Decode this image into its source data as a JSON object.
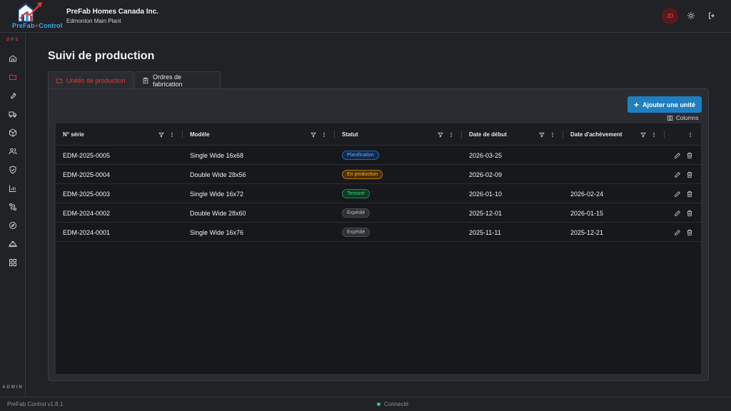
{
  "header": {
    "logo_text_a": "PreFab",
    "logo_text_sep": "+",
    "logo_text_b": "Control",
    "company": "PreFab Homes Canada Inc.",
    "plant": "Edmonton Main Plant",
    "avatar_initials": "JD"
  },
  "sidebar": {
    "section_ops": "OPS",
    "section_admin": "ADMIN",
    "items": [
      "home-icon",
      "folder-icon",
      "wrench-icon",
      "truck-icon",
      "box-icon",
      "users-icon",
      "shield-icon",
      "chart-icon",
      "route-icon",
      "compass-icon",
      "hardhat-icon",
      "grid-icon"
    ]
  },
  "main": {
    "title": "Suivi de production",
    "tabs": [
      {
        "label": "Unités de production"
      },
      {
        "label": "Ordres de fabrication"
      }
    ],
    "add_button": "Ajouter une unité",
    "columns_button": "Columns"
  },
  "table": {
    "columns": [
      "N° série",
      "Modèle",
      "Statut",
      "Date de début",
      "Date d'achèvement"
    ],
    "rows": [
      {
        "serial": "EDM-2025-0005",
        "model": "Single Wide 16x68",
        "status": "Planification",
        "start": "2026-03-25",
        "end": ""
      },
      {
        "serial": "EDM-2025-0004",
        "model": "Double Wide 28x56",
        "status": "En production",
        "start": "2026-02-09",
        "end": ""
      },
      {
        "serial": "EDM-2025-0003",
        "model": "Single Wide 16x72",
        "status": "Terminé",
        "start": "2026-01-10",
        "end": "2026-02-24"
      },
      {
        "serial": "EDM-2024-0002",
        "model": "Double Wide 28x60",
        "status": "Expédié",
        "start": "2025-12-01",
        "end": "2026-01-15"
      },
      {
        "serial": "EDM-2024-0001",
        "model": "Single Wide 16x76",
        "status": "Expédié",
        "start": "2025-11-11",
        "end": "2025-12-21"
      }
    ]
  },
  "footer": {
    "version": "PreFab Control v1.8.1",
    "connection": "Connecté"
  },
  "colors": {
    "accent_red": "#e53935",
    "primary_blue": "#1f7fc1",
    "status_planification": "#6fa8ff",
    "status_en_production": "#ffb133",
    "status_termine": "#3bd57e",
    "status_expedie": "#b8bac0",
    "connected_dot": "#2ecc71"
  }
}
